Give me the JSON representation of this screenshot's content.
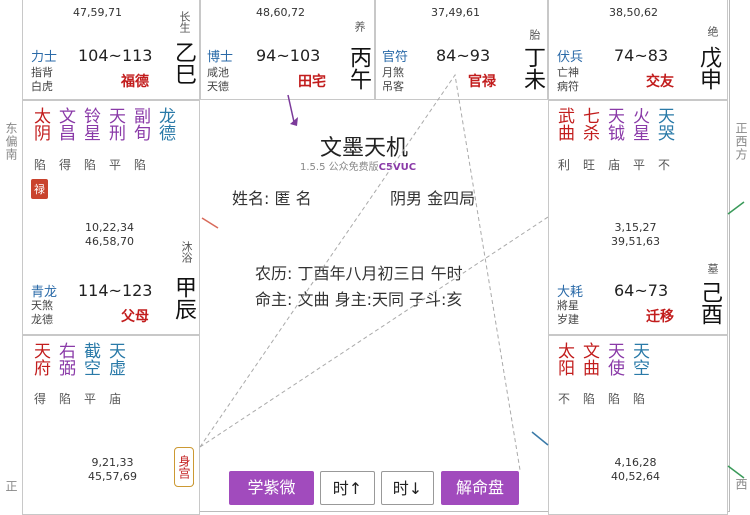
{
  "sides": {
    "left_top": "东偏南",
    "right_top": "正西方",
    "left_bottom": "正",
    "right_bottom": "西"
  },
  "cells": {
    "si": {
      "nums": "47,59,71",
      "god1": "力士",
      "god2a": "指背",
      "god2b": "白虎",
      "range": "104~113",
      "palace": "福德",
      "stage": "长生",
      "gz": "乙巳",
      "stars": [
        {
          "c": "太",
          "c2": "阴",
          "b": "陷"
        },
        {
          "c": "文",
          "c2": "昌",
          "b": "得"
        },
        {
          "c": "铃",
          "c2": "星",
          "b": "陷"
        },
        {
          "c": "天",
          "c2": "刑",
          "b": "平"
        },
        {
          "c": "副",
          "c2": "旬",
          "b": "陷"
        },
        {
          "c": "龙",
          "c2": "德",
          "b": ""
        }
      ],
      "lu": "禄"
    },
    "wu": {
      "nums": "48,60,72",
      "god1": "博士",
      "god2a": "咸池",
      "god2b": "天德",
      "range": "94~103",
      "palace": "田宅",
      "stage": "养",
      "gz": "丙午"
    },
    "wei": {
      "nums": "37,49,61",
      "god1": "官符",
      "god2a": "月煞",
      "god2b": "吊客",
      "range": "84~93",
      "palace": "官禄",
      "stage": "胎",
      "gz": "丁未"
    },
    "shen": {
      "nums": "38,50,62",
      "god1": "伏兵",
      "god2a": "亡神",
      "god2b": "病符",
      "range": "74~83",
      "palace": "交友",
      "stage": "绝",
      "gz": "戊申",
      "stars": [
        {
          "c": "武",
          "c2": "曲",
          "b": "利"
        },
        {
          "c": "七",
          "c2": "杀",
          "b": "旺"
        },
        {
          "c": "天",
          "c2": "钺",
          "b": "庙"
        },
        {
          "c": "火",
          "c2": "星",
          "b": "平"
        },
        {
          "c": "天",
          "c2": "哭",
          "b": "不"
        }
      ]
    },
    "chen": {
      "nums1": "10,22,34",
      "nums2": "46,58,70",
      "god1": "青龙",
      "god2a": "天煞",
      "god2b": "龙德",
      "range": "114~123",
      "palace": "父母",
      "stage": "沐浴",
      "gz": "甲辰"
    },
    "you": {
      "nums1": "3,15,27",
      "nums2": "39,51,63",
      "god1": "大耗",
      "god2a": "將星",
      "god2b": "岁建",
      "range": "64~73",
      "palace": "迁移",
      "stage": "墓",
      "gz": "己酉"
    },
    "mao": {
      "nums1": "9,21,33",
      "nums2": "45,57,69",
      "stage": "冠",
      "stars": [
        {
          "c": "天",
          "c2": "府",
          "b": "得"
        },
        {
          "c": "右",
          "c2": "弼",
          "b": "陷"
        },
        {
          "c": "截",
          "c2": "空",
          "b": "平"
        },
        {
          "c": "天",
          "c2": "虚",
          "b": "庙"
        }
      ]
    },
    "xu": {
      "nums1": "4,16,28",
      "nums2": "40,52,64",
      "stars": [
        {
          "c": "太",
          "c2": "阳",
          "b": "不"
        },
        {
          "c": "文",
          "c2": "曲",
          "b": "陷"
        },
        {
          "c": "天",
          "c2": "使",
          "b": "陷"
        },
        {
          "c": "天",
          "c2": "空",
          "b": "陷"
        }
      ]
    }
  },
  "center": {
    "title": "文墨天机",
    "version": "1.5.5 公众免费版",
    "wm": "C5VUC",
    "name": "姓名: 匿 名",
    "gender": "阴男 金四局",
    "lunar": "农历: 丁酉年八月初三日 午时",
    "ming": "命主: 文曲 身主:天同 子斗:亥"
  },
  "shen_badge": "身宫",
  "buttons": {
    "learn": "学紫微",
    "prev": "时↑",
    "next": "时↓",
    "explain": "解命盘"
  },
  "colors": {
    "accent": "#a14bbd",
    "palace": "#c21d1d",
    "star_red": "#c21d1d",
    "star_purple": "#8a3aa8",
    "star_blue": "#2a7aa8"
  }
}
